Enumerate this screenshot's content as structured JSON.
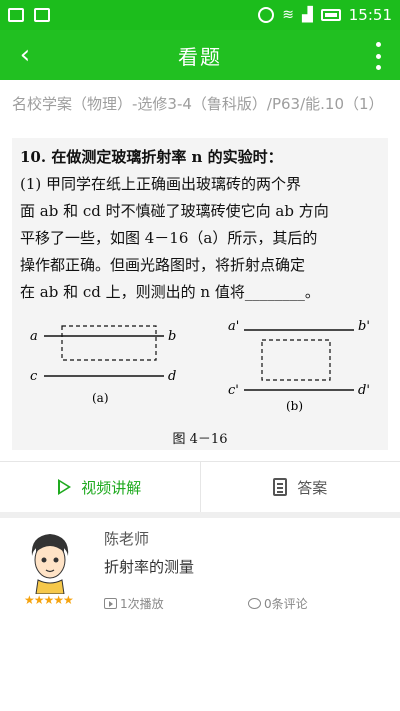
{
  "status_bar": {
    "time": "15:51"
  },
  "header": {
    "title": "看题",
    "back_icon": "back-arrow-icon",
    "menu_icon": "more-vert-icon"
  },
  "breadcrumb": "名校学案（物理）-选修3-4（鲁科版）/P63/能.10（1）",
  "question": {
    "lines": [
      "10.  在做测定玻璃折射率 n 的实验时：",
      "     (1) 甲同学在纸上正确画出玻璃砖的两个界",
      "     面 ab 和 cd 时不慎碰了玻璃砖使它向 ab 方向",
      "     平移了一些，如图 4－16（a）所示，其后的",
      "     操作都正确。但画光路图时，将折射点确定",
      "     在 ab 和 cd 上，则测出的 n 值将________。"
    ],
    "figure": {
      "a_labels": [
        "a",
        "b",
        "c",
        "d",
        "(a)"
      ],
      "b_labels": [
        "a'",
        "b'",
        "c'",
        "d'",
        "(b)"
      ],
      "caption": "图 4－16"
    }
  },
  "actions": {
    "video_label": "视频讲解",
    "answer_label": "答案"
  },
  "teacher": {
    "name": "陈老师",
    "topic": "折射率的测量",
    "stars": "★★★★★",
    "plays": "1次播放",
    "comments": "0条评论"
  },
  "colors": {
    "accent": "#21c021",
    "star": "#f5a30f"
  }
}
